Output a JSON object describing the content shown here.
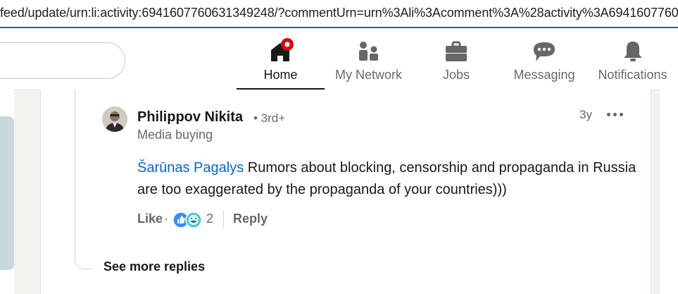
{
  "browser": {
    "url": "feed/update/urn:li:activity:6941607760631349248/?commentUrn=urn%3Ali%3Acomment%3A%28activity%3A6941607760631"
  },
  "nav": {
    "items": [
      {
        "label": "Home",
        "icon": "home-icon",
        "active": true
      },
      {
        "label": "My Network",
        "icon": "network-icon",
        "active": false
      },
      {
        "label": "Jobs",
        "icon": "briefcase-icon",
        "active": false
      },
      {
        "label": "Messaging",
        "icon": "messaging-icon",
        "active": false
      },
      {
        "label": "Notifications",
        "icon": "bell-icon",
        "active": false
      }
    ]
  },
  "comment": {
    "author": "Philippov Nikita",
    "degree": "• 3rd+",
    "headline": "Media buying",
    "timestamp": "3y",
    "mention": "Šarūnas Pagalys",
    "text": " Rumors about blocking, censorship and propaganda in Russia are too exaggerated by the propaganda of your countries)))",
    "like_label": "Like",
    "separator": "·",
    "reaction_count": "2",
    "reaction_icons": [
      "like-reaction-icon",
      "funny-reaction-icon"
    ],
    "reply_label": "Reply"
  },
  "see_more": "See more replies",
  "colors": {
    "accent": "#0a66c2",
    "notification_badge": "#cc1016",
    "background": "#f3f2ef"
  }
}
